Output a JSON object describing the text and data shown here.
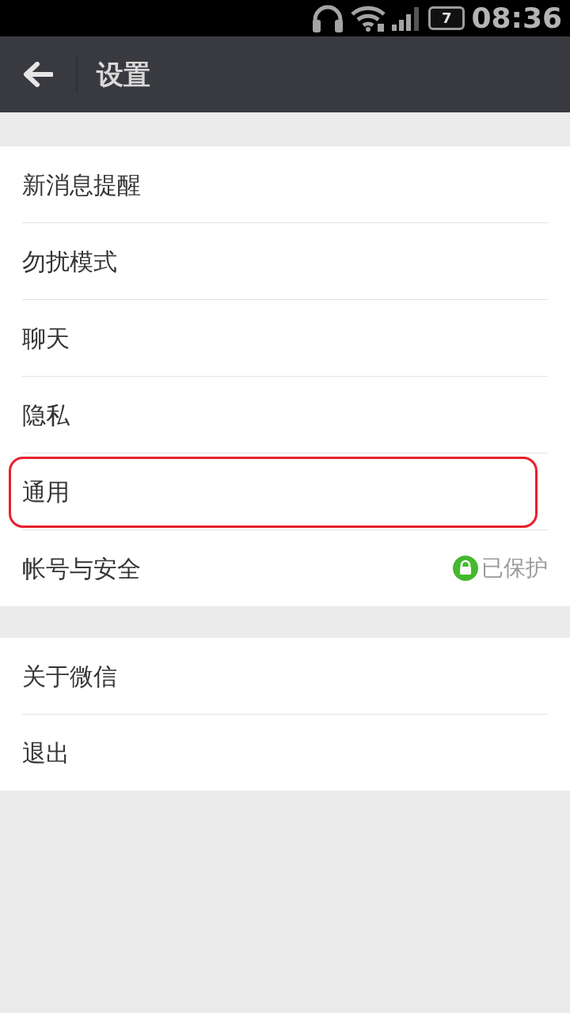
{
  "status_bar": {
    "battery": "7",
    "time": "08:36"
  },
  "app_bar": {
    "title": "设置"
  },
  "groups": [
    {
      "items": [
        {
          "label": "新消息提醒",
          "highlighted": false
        },
        {
          "label": "勿扰模式",
          "highlighted": false
        },
        {
          "label": "聊天",
          "highlighted": false
        },
        {
          "label": "隐私",
          "highlighted": false
        },
        {
          "label": "通用",
          "highlighted": true
        },
        {
          "label": "帐号与安全",
          "highlighted": false,
          "status": "已保护"
        }
      ]
    },
    {
      "items": [
        {
          "label": "关于微信",
          "highlighted": false
        },
        {
          "label": "退出",
          "highlighted": false
        }
      ]
    }
  ]
}
